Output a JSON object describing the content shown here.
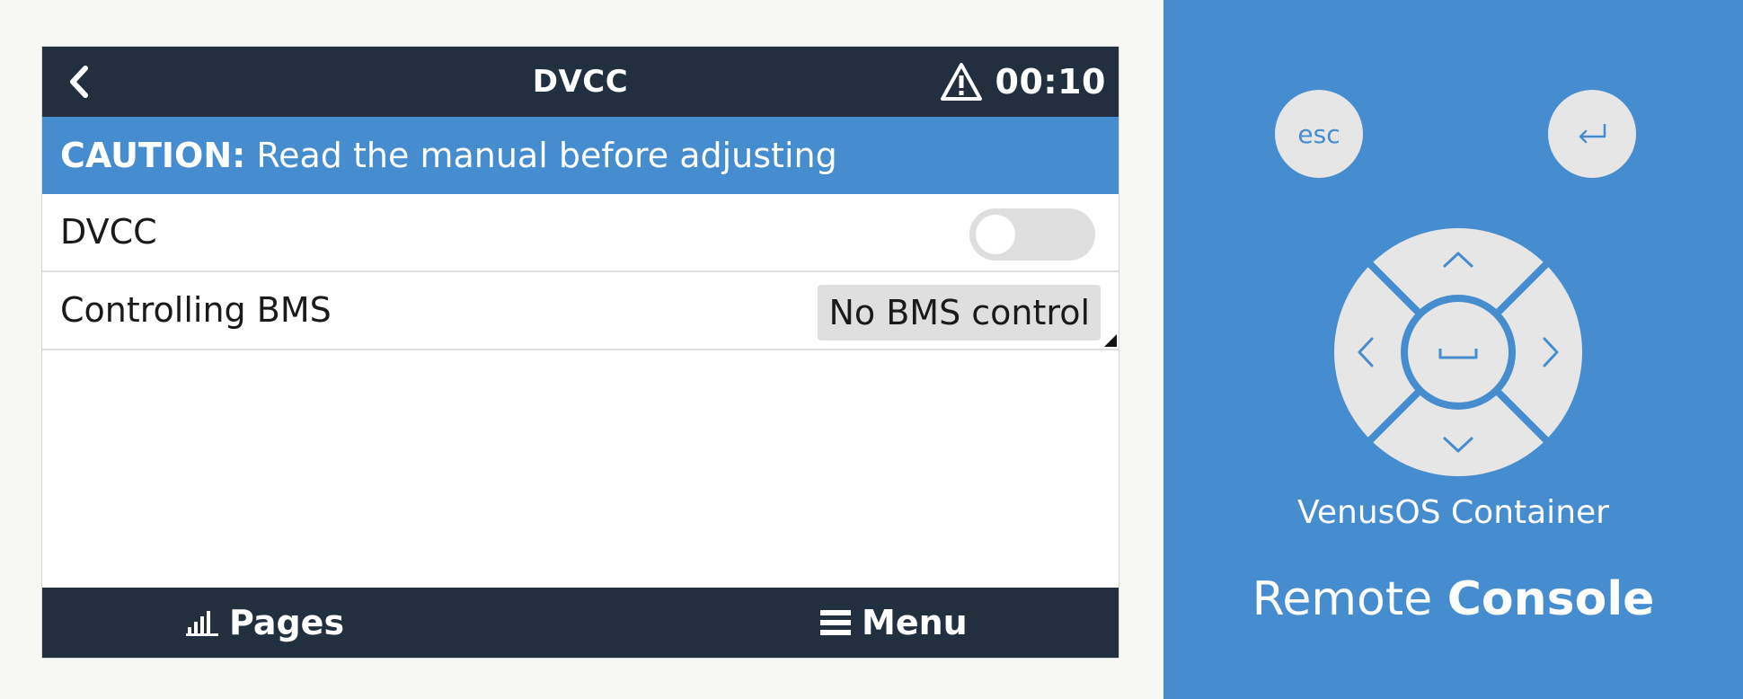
{
  "header": {
    "title": "DVCC",
    "clock": "00:10",
    "back_icon": "chevron-left-icon",
    "alarm_icon": "warning-triangle-icon"
  },
  "caution": {
    "prefix": "CAUTION:",
    "text": " Read the manual before adjusting"
  },
  "settings": {
    "dvcc": {
      "label": "DVCC",
      "enabled": false
    },
    "controlling_bms": {
      "label": "Controlling BMS",
      "value": "No BMS control"
    }
  },
  "footer": {
    "pages_label": "Pages",
    "pages_icon": "bar-chart-icon",
    "menu_label": "Menu",
    "menu_icon": "hamburger-icon"
  },
  "remote": {
    "esc_label": "esc",
    "enter_icon": "enter-return-icon",
    "device_name": "VenusOS Container",
    "brand_light": "Remote ",
    "brand_bold": "Console"
  },
  "colors": {
    "header_bg": "#222f3e",
    "accent_blue": "#458dcf",
    "control_gray": "#dedede",
    "remote_button": "#e6e6e6"
  }
}
